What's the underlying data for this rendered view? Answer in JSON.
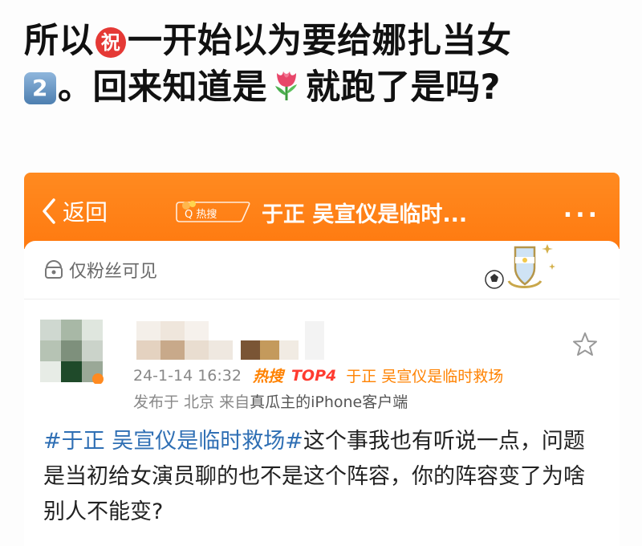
{
  "headline": {
    "part1": "所以",
    "emoji1_text": "祝",
    "part2": "一开始以为要给娜扎当女",
    "emoji2_text": "2",
    "part3": "。回来知道是",
    "part4": "就跑了是吗?"
  },
  "navbar": {
    "back_label": "返回",
    "hot_badge": "Q 热搜",
    "title": "于正 吴宣仪是临时...",
    "more": "...",
    "color": "#ff8213"
  },
  "visibility": {
    "label": "仅粉丝可见"
  },
  "post": {
    "meta_time": "24-1-14 16:32",
    "meta_hot": "热搜",
    "meta_top": "TOP4",
    "meta_topic": "于正 吴宣仪是临时救场",
    "meta_from": "发布于 北京 来自",
    "meta_client": "真瓜主的iPhone客户端",
    "hashtag": "#于正 吴宣仪是临时救场#",
    "text": "这个事我也有听说一点，问题是当初给女演员聊的也不是这个阵容，你的阵容变了为啥别人不能变?"
  }
}
